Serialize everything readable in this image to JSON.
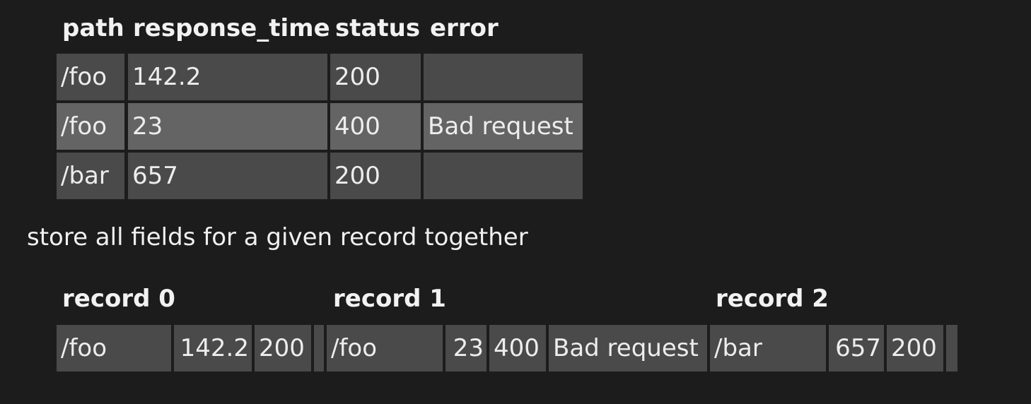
{
  "table": {
    "headers": [
      "path",
      "response_time",
      "status",
      "error"
    ],
    "rows": [
      [
        "/foo",
        "142.2",
        "200",
        ""
      ],
      [
        "/foo",
        "23",
        "400",
        "Bad request"
      ],
      [
        "/bar",
        "657",
        "200",
        ""
      ]
    ]
  },
  "caption": "store all fields for a given record together",
  "records": [
    {
      "label": "record 0",
      "path": "/foo",
      "response_time": "142.2",
      "status": "200",
      "error": ""
    },
    {
      "label": "record 1",
      "path": "/foo",
      "response_time": "23",
      "status": "400",
      "error": "Bad request"
    },
    {
      "label": "record 2",
      "path": "/bar",
      "response_time": "657",
      "status": "200",
      "error": ""
    }
  ],
  "colors": {
    "background": "#1c1c1c",
    "cell": "#4a4a4a",
    "cell_highlight": "#646464",
    "text": "#efefef"
  }
}
